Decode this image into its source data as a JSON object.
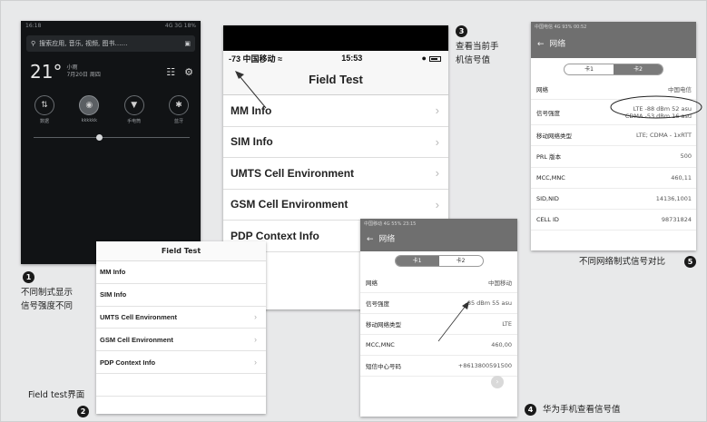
{
  "screen1": {
    "status_left": "16:18",
    "status_right": "4G 3G 18%",
    "search_placeholder": "搜索应用, 音乐, 视频, 图书……",
    "temperature": "21°",
    "weather_line1": "小雨",
    "weather_line2": "7月20日 周四",
    "toggles": [
      {
        "label": "数据",
        "icon": "data-icon",
        "on": false
      },
      {
        "label": "kkkkkk",
        "icon": "wifi-icon",
        "on": true
      },
      {
        "label": "手电筒",
        "icon": "flashlight-icon",
        "on": false
      },
      {
        "label": "蓝牙",
        "icon": "bluetooth-icon",
        "on": false
      }
    ],
    "brightness_level": 0.42
  },
  "screen2": {
    "title": "Field Test",
    "items": [
      "MM Info",
      "SIM Info",
      "UMTS Cell Environment",
      "GSM Cell Environment",
      "PDP Context Info",
      ""
    ]
  },
  "screen3": {
    "signal": "-73",
    "carrier": "中国移动",
    "time": "15:53",
    "title": "Field Test",
    "items": [
      "MM Info",
      "SIM Info",
      "UMTS Cell Environment",
      "GSM Cell Environment",
      "PDP Context Info"
    ]
  },
  "screen4": {
    "status": "中国移动 4G 55% 23:15",
    "title": "网络",
    "tabs": [
      "卡1",
      "卡2"
    ],
    "rows": [
      {
        "label": "网络",
        "value": "中国移动"
      },
      {
        "label": "信号强度",
        "value": "-85 dBm  55 asu"
      },
      {
        "label": "移动网络类型",
        "value": "LTE"
      },
      {
        "label": "MCC,MNC",
        "value": "460,00"
      },
      {
        "label": "短信中心号码",
        "value": "+8613800591500"
      }
    ]
  },
  "screen5": {
    "status": "中国电信 4G 93% 00:52",
    "title": "网络",
    "tabs": [
      "卡1",
      "卡2"
    ],
    "rows": [
      {
        "label": "网络",
        "value": "中国电信"
      },
      {
        "label": "信号强度",
        "value": "LTE -88 dBm  52 asu",
        "value2": "CDMA -53 dBm  16 asu"
      },
      {
        "label": "移动网络类型",
        "value": "LTE; CDMA - 1xRTT"
      },
      {
        "label": "PRL 版本",
        "value": "500"
      },
      {
        "label": "MCC,MNC",
        "value": "460,11"
      },
      {
        "label": "SID,NID",
        "value": "14136,1001"
      },
      {
        "label": "CELL ID",
        "value": "98731824"
      }
    ]
  },
  "captions": {
    "n1": "1",
    "c1_line1": "不同制式显示",
    "c1_line2": "信号强度不同",
    "n2": "2",
    "c2": "Field test界面",
    "n3": "3",
    "c3_line1": "查看当前手",
    "c3_line2": "机信号值",
    "n4": "4",
    "c4": "华为手机查看信号值",
    "n5": "5",
    "c5": "不同网络制式信号对比"
  }
}
